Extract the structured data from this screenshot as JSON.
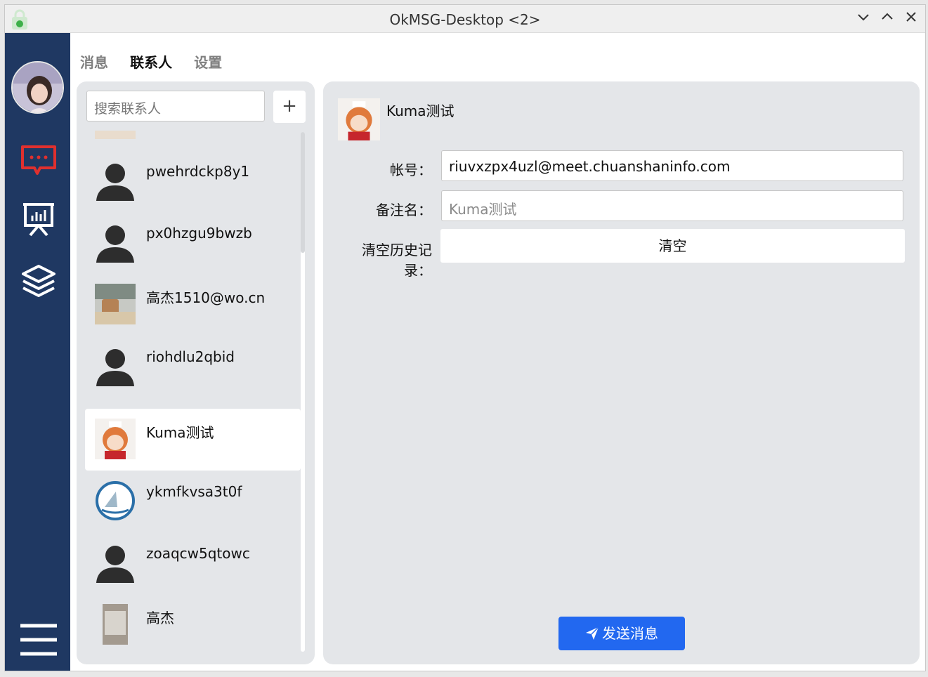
{
  "window": {
    "title": "OkMSG-Desktop <2>"
  },
  "tabs": [
    {
      "label": "消息"
    },
    {
      "label": "联系人"
    },
    {
      "label": "设置"
    }
  ],
  "search": {
    "placeholder": "搜索联系人"
  },
  "add_label": "+",
  "contacts": [
    {
      "name": "pwehrdckp8y1",
      "avatar": "default-person-icon"
    },
    {
      "name": "px0hzgu9bwzb",
      "avatar": "default-person-icon"
    },
    {
      "name": "高杰1510@wo.cn",
      "avatar": "photo"
    },
    {
      "name": "riohdlu2qbid",
      "avatar": "default-person-icon"
    },
    {
      "name": "Kuma测试",
      "avatar": "anime-avatar"
    },
    {
      "name": "ykmfkvsa3t0f",
      "avatar": "sailboat-logo"
    },
    {
      "name": "zoaqcw5qtowc",
      "avatar": "default-person-icon"
    },
    {
      "name": "高杰",
      "avatar": "photo"
    }
  ],
  "detail": {
    "name": "Kuma测试",
    "account_label": "帐号：",
    "account_value": "riuvxzpx4uzl@meet.chuanshaninfo.com",
    "remark_label": "备注名：",
    "remark_placeholder": "Kuma测试",
    "history_label": "清空历史记录：",
    "clear_button": "清空",
    "send_button": "发送消息"
  },
  "colors": {
    "sidebar": "#1f3862",
    "accent_red": "#e0302e",
    "primary": "#2268f0"
  }
}
